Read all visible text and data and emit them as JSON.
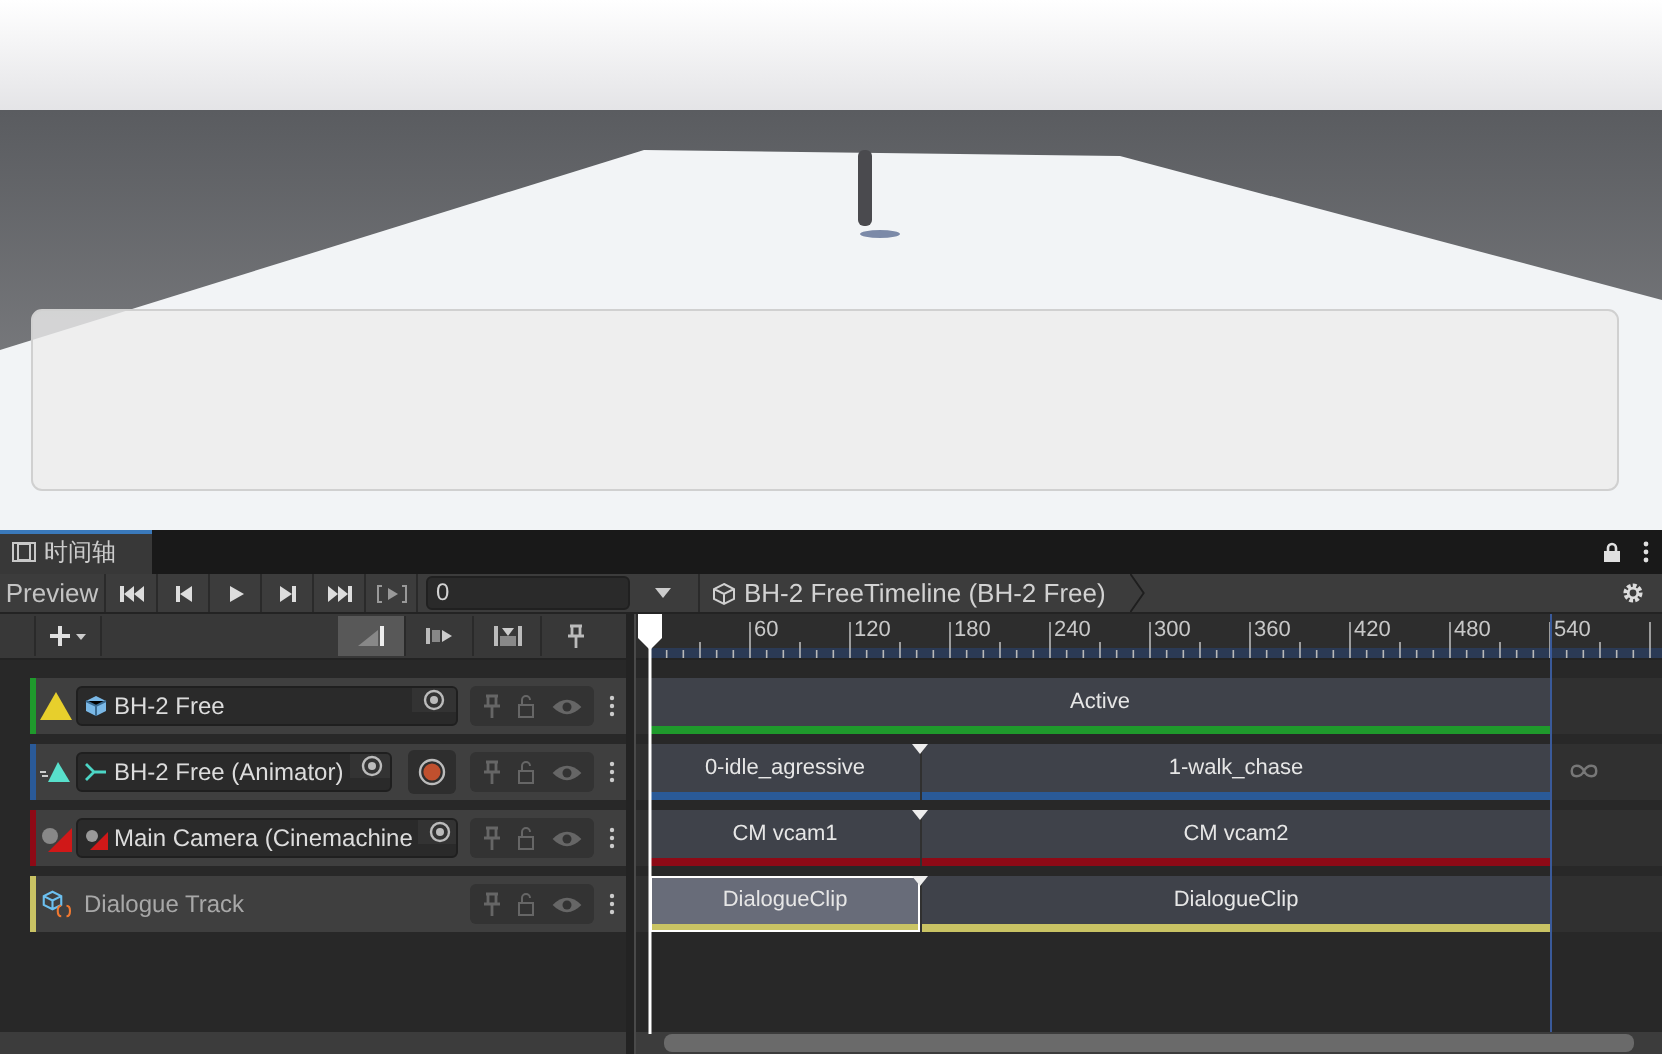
{
  "window": {
    "tab": {
      "label": "时间轴",
      "selected": true
    }
  },
  "toolbar": {
    "preview_label": "Preview",
    "frame_value": "0",
    "breadcrumb": "BH-2 FreeTimeline (BH-2 Free)"
  },
  "edit_modes": [
    {
      "selected": true
    },
    {
      "selected": false
    },
    {
      "selected": false
    }
  ],
  "ruler": {
    "labels": [
      "60",
      "120",
      "180",
      "240",
      "300",
      "360",
      "420",
      "480",
      "540"
    ]
  },
  "tracks": [
    {
      "kind": "activation",
      "name": "BH-2 Free",
      "color": "#1f9a2c",
      "clips": [
        {
          "label": "Active",
          "selected": false
        }
      ]
    },
    {
      "kind": "animation",
      "name": "BH-2 Free (Animator)",
      "color": "#2a5a98",
      "clips": [
        {
          "label": "0-idle_agressive",
          "selected": false
        },
        {
          "label": "1-walk_chase",
          "selected": false
        }
      ]
    },
    {
      "kind": "cinemachine",
      "name": "Main Camera (Cinemachine",
      "color": "#8e0a16",
      "clips": [
        {
          "label": "CM vcam1",
          "selected": false
        },
        {
          "label": "CM vcam2",
          "selected": false
        }
      ]
    },
    {
      "kind": "dialogue",
      "name": "Dialogue Track",
      "color": "#c9c364",
      "clips": [
        {
          "label": "DialogueClip",
          "selected": true
        },
        {
          "label": "DialogueClip",
          "selected": false
        }
      ]
    }
  ]
}
